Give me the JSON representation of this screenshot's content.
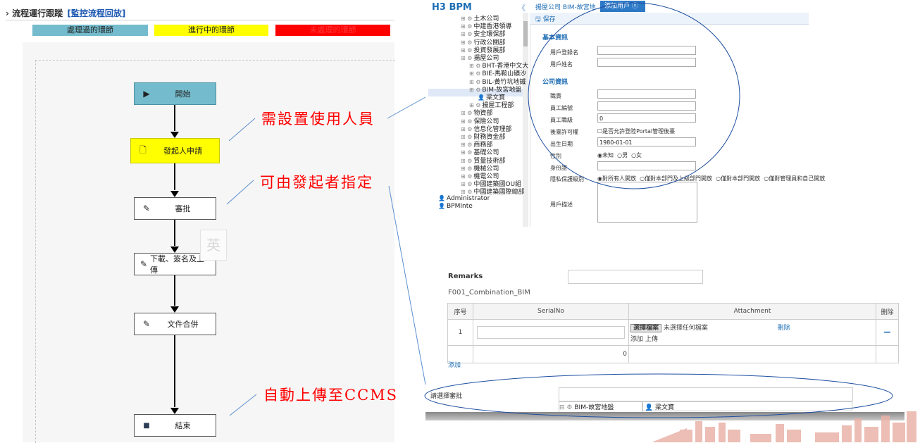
{
  "flow": {
    "title": "流程運行跟蹤",
    "title_link": "[監控流程回放]",
    "legend": {
      "done": "處理過的環節",
      "current": "進行中的環節",
      "pending": "未處理的環節"
    },
    "nodes": {
      "start": "開始",
      "apply": "發起人申請",
      "approve": "審批",
      "download": "下載、簽名及上傳",
      "merge": "文件合併",
      "end": "結束"
    },
    "ime_char": "英"
  },
  "annotations": {
    "set_users": "需設置使用人員",
    "by_initiator": "可由發起者指定",
    "auto_upload": "自動上傳至CCMS"
  },
  "bpm": {
    "logo": "H3 BPM",
    "collapse": "《",
    "tabs": {
      "company": "揚屋公司 BIM-故宮地... ⓧ",
      "add_user": "添加用戶 ⓧ"
    },
    "save": "保存",
    "tree": [
      "土木公司",
      "中建香港領導",
      "安全環保部",
      "行政公關部",
      "投資發展部",
      "揚屋公司",
      "BHT-香港中文大",
      "BIE-馬鞍山礦沙",
      "BIL-黃竹坑地鐵",
      "BIM-故宮地盤",
      "梁文寶",
      "揚屋工程部",
      "物資部",
      "保險公司",
      "信息化管理部",
      "財務資金部",
      "商務部",
      "基礎公司",
      "質量技術部",
      "機械公司",
      "機電公司",
      "中國建築國OU組",
      "中國建築國際總部",
      "Administrator",
      "BPMInte"
    ],
    "sections": {
      "basic": "基本資訊",
      "company": "公司資訊"
    },
    "fields": {
      "login_name": "用戶登錄名",
      "user_name": "用戶姓名",
      "title": "職責",
      "emp_no": "員工編號",
      "emp_level": "員工職級",
      "emp_level_value": "0",
      "backend": "後臺許可權",
      "backend_opt": "是否允許登陸Portal管理後臺",
      "birthday": "出生日期",
      "birthday_value": "1980-01-01",
      "gender": "性別",
      "gender_unknown": "未知",
      "gender_male": "男",
      "gender_female": "女",
      "id_no": "身份證",
      "privacy": "隱私保護級別",
      "privacy_1": "對所有人開放",
      "privacy_2": "僅對本部門及上級部門開放",
      "privacy_3": "僅對本部門開放",
      "privacy_4": "僅對管理員和自己開放",
      "desc": "用戶描述"
    }
  },
  "form": {
    "remarks": "Remarks",
    "code": "F001_Combination_BIM",
    "headers": [
      "序号",
      "SerialNo",
      "Attachment",
      "删除"
    ],
    "row_no": "1",
    "choose_file": "選擇檔案",
    "no_file": "未選擇任何檔案",
    "delete_link": "刪除",
    "add_upload": "添加  上傳",
    "minus": "−",
    "total": "0",
    "add": "添加",
    "approver_label": "請選擇審批",
    "approver_tree": "BIM-故宮地盤",
    "approver_user": "梁文寶"
  },
  "colors": {
    "done": "#74bccd",
    "current": "#ffff00",
    "pending": "#ff0000",
    "annotation": "#ff0000",
    "bpm_blue": "#2c79c6"
  }
}
